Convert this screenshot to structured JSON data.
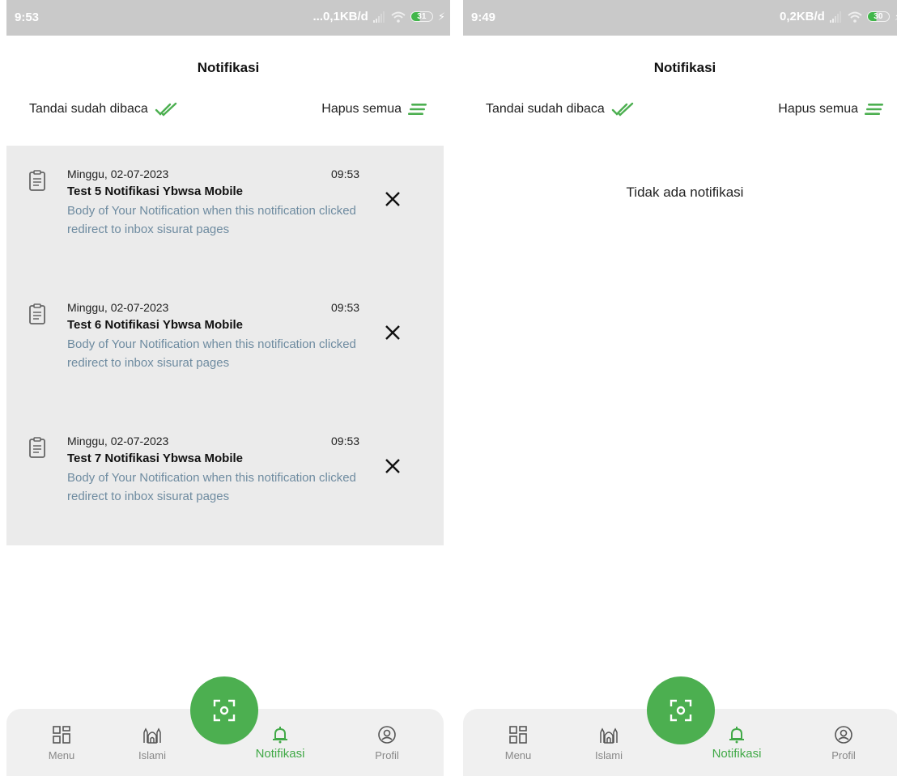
{
  "colors": {
    "accent": "#4caf50",
    "body_text": "#6e8ba0",
    "list_bg": "#ebebeb",
    "status_bar": "#c9c9c9"
  },
  "left": {
    "status": {
      "time": "9:53",
      "net": "...0,1KB/d",
      "battery": "31"
    },
    "title": "Notifikasi",
    "mark_read": "Tandai sudah dibaca",
    "delete_all": "Hapus semua",
    "notifications": [
      {
        "date": "Minggu, 02-07-2023",
        "time": "09:53",
        "title": "Test 5 Notifikasi Ybwsa Mobile",
        "body": "Body of Your Notification when this notification clicked redirect to inbox sisurat pages",
        "icon": "clipboard-icon"
      },
      {
        "date": "Minggu, 02-07-2023",
        "time": "09:53",
        "title": "Test 6 Notifikasi Ybwsa Mobile",
        "body": "Body of Your Notification when this notification clicked redirect to inbox sisurat pages",
        "icon": "clipboard-icon"
      },
      {
        "date": "Minggu, 02-07-2023",
        "time": "09:53",
        "title": "Test 7 Notifikasi Ybwsa Mobile",
        "body": "Body of Your Notification when this notification clicked redirect to inbox sisurat pages",
        "icon": "clipboard-icon"
      }
    ],
    "nav": {
      "menu": "Menu",
      "islami": "Islami",
      "notifikasi": "Notifikasi",
      "profil": "Profil"
    }
  },
  "right": {
    "status": {
      "time": "9:49",
      "net": "0,2KB/d",
      "battery": "30"
    },
    "title": "Notifikasi",
    "mark_read": "Tandai sudah dibaca",
    "delete_all": "Hapus semua",
    "empty": "Tidak ada notifikasi",
    "nav": {
      "menu": "Menu",
      "islami": "Islami",
      "notifikasi": "Notifikasi",
      "profil": "Profil"
    }
  }
}
